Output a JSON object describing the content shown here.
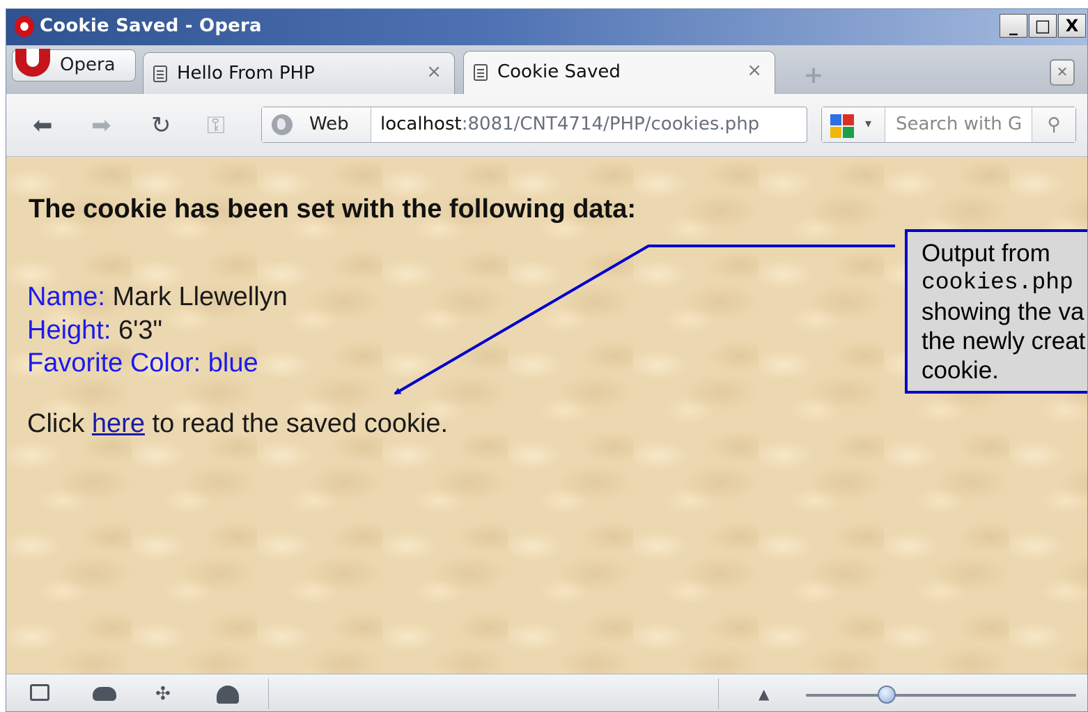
{
  "window": {
    "title": "Cookie Saved - Opera",
    "controls": {
      "minimize": "_",
      "maximize": "□",
      "close": "X"
    }
  },
  "tabs": {
    "menu_label": "Opera",
    "items": [
      {
        "label": "Hello From PHP",
        "close": "×",
        "active": false
      },
      {
        "label": "Cookie Saved",
        "close": "×",
        "active": true
      }
    ],
    "new_tab_icon": "plus-icon",
    "trash_icon": "closed-tabs-trash-icon"
  },
  "navbar": {
    "icons": [
      "back-arrow-icon",
      "forward-arrow-icon",
      "reload-icon",
      "key-icon"
    ],
    "web_label": "Web",
    "url_host": "localhost",
    "url_rest": ":8081/CNT4714/PHP/cookies.php",
    "search_placeholder": "Search with Go"
  },
  "page": {
    "heading": "The cookie has been set with the following data:",
    "fields": [
      {
        "key": "Name:",
        "value": " Mark Llewellyn"
      },
      {
        "key": "Height:",
        "value": " 6'3\""
      },
      {
        "key": "Favorite Color:",
        "value": " blue"
      }
    ],
    "click_prefix": "Click ",
    "click_link": "here",
    "click_suffix": " to read the saved cookie."
  },
  "callout": {
    "line1": "Output from",
    "line2": "cookies.php",
    "line3": "showing the va",
    "line4": "the newly creat",
    "line5": "cookie."
  },
  "statusbar": {
    "icons": [
      "panel-toggle-icon",
      "cloud-sync-icon",
      "unite-icon",
      "speed-dial-icon",
      "up-arrow-icon"
    ],
    "zoom_slider_level": 0.3
  },
  "colors": {
    "field_key": "#1a1aee",
    "link": "#1b1ba6",
    "callout_border": "#0000cc",
    "titlebar_start": "#2f5290"
  }
}
